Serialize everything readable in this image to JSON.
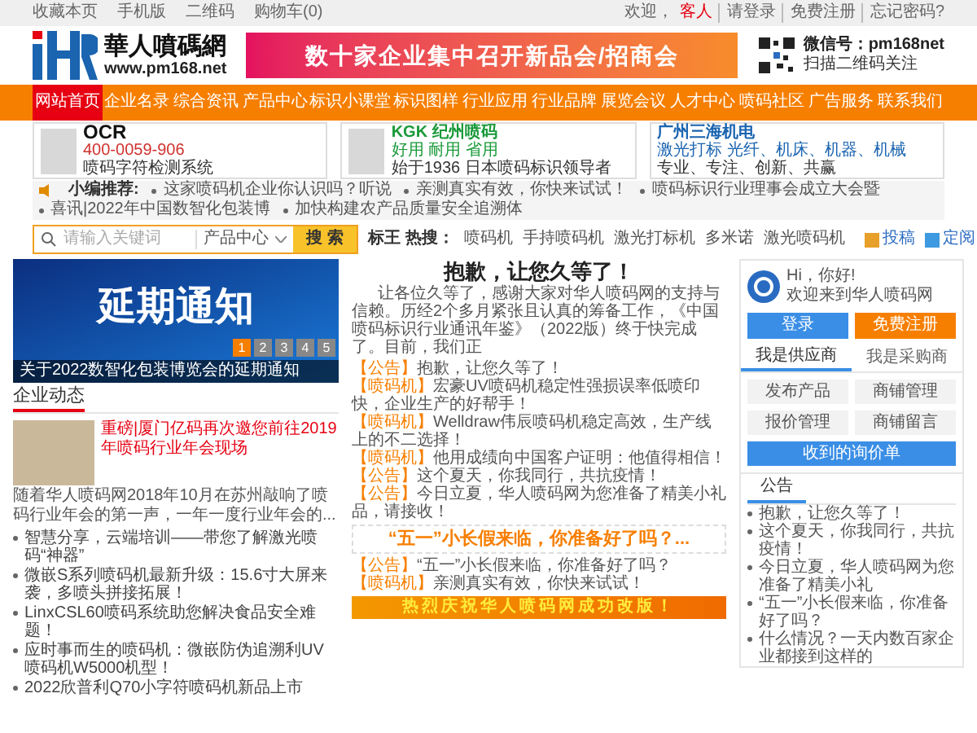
{
  "top_bar": {
    "links": [
      "收藏本页",
      "手机版",
      "二维码",
      "购物车(0)"
    ],
    "welcome": "欢迎，",
    "user": "客人",
    "account_links": [
      "请登录",
      "免费注册",
      "忘记密码?"
    ]
  },
  "header": {
    "logo": "華人噴碼網",
    "url": "www.pm168.net",
    "banner": "数十家企业集中召开新品会/招商会",
    "wechat": "微信号：pm168net",
    "qr_caption": "扫描二维码关注"
  },
  "nav": [
    {
      "label": "网站首页",
      "selected": true
    },
    {
      "label": "企业名录",
      "selected": false
    },
    {
      "label": "综合资讯",
      "selected": false
    },
    {
      "label": "产品中心",
      "selected": false
    },
    {
      "label": "标识小课堂",
      "selected": false
    },
    {
      "label": "标识图样",
      "selected": false
    },
    {
      "label": "行业应用",
      "selected": false
    },
    {
      "label": "行业品牌",
      "selected": false
    },
    {
      "label": "展览会议",
      "selected": false
    },
    {
      "label": "人才中心",
      "selected": false
    },
    {
      "label": "喷码社区",
      "selected": false
    },
    {
      "label": "广告服务",
      "selected": false
    },
    {
      "label": "联系我们",
      "selected": false
    }
  ],
  "ads": [
    {
      "kind": "ocr",
      "title": "OCR",
      "phone": "400-0059-906",
      "text": "喷码字符检测系统"
    },
    {
      "kind": "kgk",
      "title": "KGK 纪州喷码",
      "phone": "好用 耐用 省用",
      "text": "始于1936 日本喷码标识领导者"
    },
    {
      "kind": "sanhai",
      "title": "广州三海机电",
      "phone": "激光打标 光纤、机床、机器、机械",
      "text": "专业、专注、创新、共赢"
    }
  ],
  "ticker": {
    "label": "小编推荐:",
    "items": [
      "这家喷码机企业你认识吗？听说",
      "亲测真实有效，你快来试试！",
      "喷码标识行业理事会成立大会暨",
      "喜讯|2022年中国数智化包装博",
      "加快构建农产品质量安全追溯体"
    ]
  },
  "search": {
    "placeholder": "请输入关键词",
    "category": "产品中心",
    "button": "搜 索",
    "hot_label": "标王 热搜：",
    "hot": [
      "喷码机",
      "手持喷码机",
      "激光打标机",
      "多米诺",
      "激光喷码机"
    ],
    "actions": [
      "投稿",
      "定阅"
    ]
  },
  "carousel": {
    "image_text": "延期通知",
    "caption": "关于2022数智化包装博览会的延期通知",
    "pages": [
      {
        "label": "1",
        "selected": true
      },
      {
        "label": "2",
        "selected": false
      },
      {
        "label": "3",
        "selected": false
      },
      {
        "label": "4",
        "selected": false
      },
      {
        "label": "5",
        "selected": false
      }
    ]
  },
  "company_news": {
    "heading": "企业动态",
    "featured": {
      "title": "重磅|厦门亿码再次邀您前往2019年喷码行业年会现场",
      "desc": "随着华人喷码网2018年10月在苏州敲响了喷码行业年会的第一声，一年一度行业年会的..."
    },
    "items": [
      "智慧分享，云端培训——带您了解激光喷码“神器”",
      "微嵌S系列喷码机最新升级：15.6寸大屏来袭，多喷头拼接拓展！",
      "LinxCSL60喷码系统助您解决食品安全难题！",
      "应时事而生的喷码机：微嵌防伪追溯利UV喷码机W5000机型！",
      "2022欣普利Q70小字符喷码机新品上市"
    ]
  },
  "notice": {
    "title": "抱歉，让您久等了！",
    "paragraph": "让各位久等了，感谢大家对华人喷码网的支持与信赖。历经2个多月紧张且认真的筹备工作，《中国喷码标识行业通讯年鉴》（2022版）终于快完成了。目前，我们正",
    "items": [
      {
        "tag": "【公告】",
        "text": "抱歉，让您久等了！"
      },
      {
        "tag": "【喷码机】",
        "text": "宏豪UV喷码机稳定性强损误率低喷印快，企业生产的好帮手！"
      },
      {
        "tag": "【喷码机】",
        "text": "Welldraw伟辰喷码机稳定高效，生产线上的不二选择！"
      },
      {
        "tag": "【喷码机】",
        "text": "他用成绩向中国客户证明：他值得相信！"
      },
      {
        "tag": "【公告】",
        "text": "这个夏天，你我同行，共抗疫情！"
      },
      {
        "tag": "【公告】",
        "text": "今日立夏，华人喷码网为您准备了精美小礼品，请接收！"
      }
    ],
    "headline": "“五一”小长假来临，你准备好了吗？...",
    "items2": [
      {
        "tag": "【公告】",
        "text": "“五一”小长假来临，你准备好了吗？"
      },
      {
        "tag": "【喷码机】",
        "text": "亲测真实有效，你快来试试！"
      }
    ],
    "banner": "热烈庆祝华人喷码网成功改版！"
  },
  "user_box": {
    "greeting": "Hi，你好!",
    "welcome": "欢迎来到华人喷码网",
    "login": "登录",
    "register": "免费注册",
    "tabs": [
      {
        "label": "我是供应商",
        "selected": true
      },
      {
        "label": "我是采购商",
        "selected": false
      }
    ],
    "actions": [
      "发布产品",
      "商铺管理",
      "报价管理",
      "商铺留言"
    ],
    "inquiry": "收到的询价单"
  },
  "announcements": {
    "heading": "公告",
    "items": [
      "抱歉，让您久等了！",
      "这个夏天，你我同行，共抗疫情！",
      "今日立夏，华人喷码网为您准备了精美小礼",
      "“五一”小长假来临，你准备好了吗？",
      "什么情况？一天内数百家企业都接到这样的"
    ]
  }
}
